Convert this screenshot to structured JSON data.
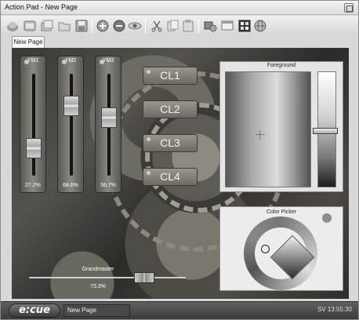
{
  "window": {
    "title": "Action Pad - New Page"
  },
  "toolbar": {
    "buttons": [
      {
        "icon": "open-folder-icon"
      },
      {
        "icon": "load-icon"
      },
      {
        "icon": "copy-page-icon"
      },
      {
        "icon": "folder-icon"
      },
      {
        "icon": "save-icon"
      },
      {
        "icon": "add-circle-icon"
      },
      {
        "icon": "remove-circle-icon"
      },
      {
        "icon": "eye-icon"
      },
      {
        "icon": "cut-icon"
      },
      {
        "icon": "copy-icon"
      },
      {
        "icon": "paste-icon"
      },
      {
        "icon": "tools-icon"
      },
      {
        "icon": "window-icon"
      },
      {
        "icon": "grid-icon"
      },
      {
        "icon": "globe-icon"
      }
    ]
  },
  "tabs": [
    {
      "label": "New Page"
    }
  ],
  "faders": [
    {
      "label": "YM1",
      "value": "27.2%",
      "level": 0.272
    },
    {
      "label": "YM2",
      "value": "68.6%",
      "level": 0.686
    },
    {
      "label": "YM3",
      "value": "56.7%",
      "level": 0.567
    }
  ],
  "cue_lists": [
    {
      "label": "CL1"
    },
    {
      "label": "CL2"
    },
    {
      "label": "CL3"
    },
    {
      "label": "CL4"
    }
  ],
  "foreground": {
    "title": "Foreground"
  },
  "color_picker": {
    "title": "Color Picker"
  },
  "grandmaster": {
    "label": "Grandmaster",
    "value": "73.3%",
    "level": 0.733
  },
  "statusbar": {
    "logo": "e:cue",
    "page": "New Page",
    "right": "SV 13:55:30"
  }
}
